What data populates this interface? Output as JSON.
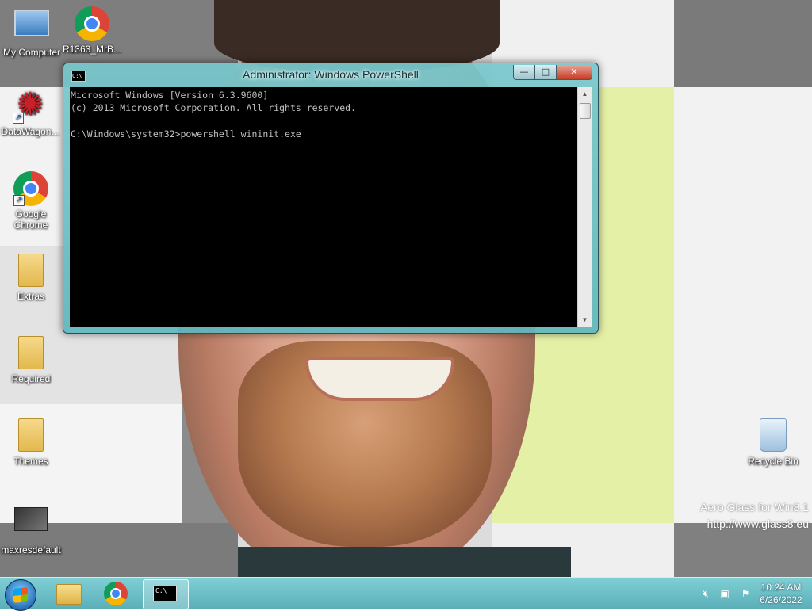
{
  "desktop": {
    "icons": [
      {
        "label": "My Computer",
        "icon": "computer-icon"
      },
      {
        "label": "R1363_MrB...",
        "icon": "chrome-file-icon"
      },
      {
        "label": "DataWagon...",
        "icon": "datawagon-icon"
      },
      {
        "label": "Google Chrome",
        "icon": "chrome-icon"
      },
      {
        "label": "Extras",
        "icon": "folder-icon"
      },
      {
        "label": "Required",
        "icon": "folder-icon"
      },
      {
        "label": "Themes",
        "icon": "folder-icon"
      },
      {
        "label": "maxresdefault",
        "icon": "image-file-icon"
      },
      {
        "label": "Recycle Bin",
        "icon": "recycle-bin-icon"
      }
    ],
    "watermark": {
      "line1": "Aero Glass for Win8.1",
      "line2": "http://www.glass8.eu"
    }
  },
  "window": {
    "title": "Administrator: Windows PowerShell",
    "console_lines": [
      "Microsoft Windows [Version 6.3.9600]",
      "(c) 2013 Microsoft Corporation. All rights reserved.",
      "",
      "C:\\Windows\\system32>powershell wininit.exe"
    ],
    "buttons": {
      "minimize": "—",
      "maximize": "□",
      "close": "✕"
    }
  },
  "taskbar": {
    "clock_time": "10:24 AM",
    "clock_date": "6/26/2022",
    "pinned": [
      "file-explorer-icon",
      "chrome-icon",
      "powershell-icon"
    ],
    "ps_glyph": "C:\\_"
  }
}
